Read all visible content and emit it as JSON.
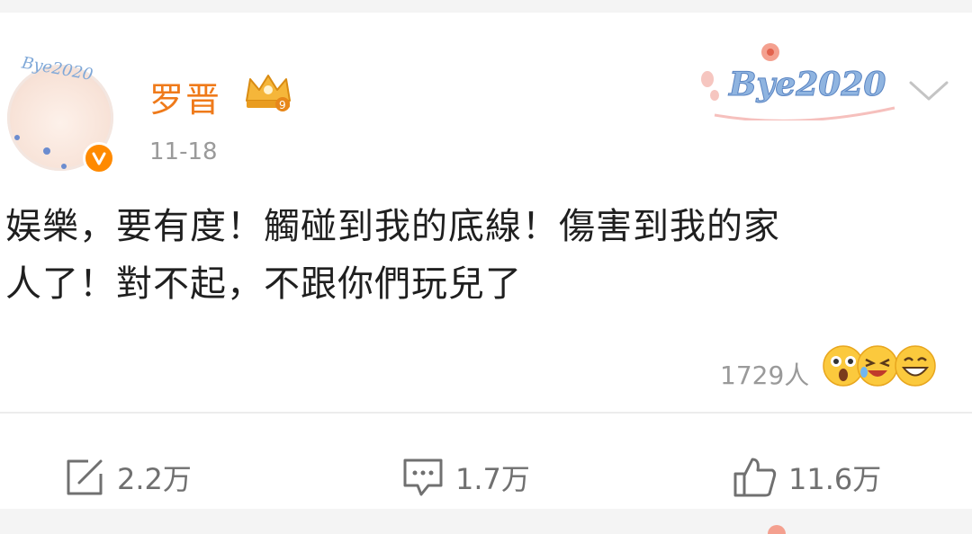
{
  "post": {
    "author": "罗晋",
    "date": "11-18",
    "avatar_badge_text": "Bye2020",
    "decoration_text": "Bye2020",
    "text_line1": "娱樂，要有度！觸碰到我的底線！傷害到我的家",
    "text_line2": "人了！對不起，不跟你們玩兒了",
    "reaction_count": "1729人"
  },
  "actions": {
    "repost": "2.2万",
    "comment": "1.7万",
    "like": "11.6万"
  },
  "icons": {
    "verified": "verified-v-icon",
    "crown": "vip-crown-icon",
    "chevron": "chevron-down-icon",
    "repost": "repost-icon",
    "comment": "comment-icon",
    "like": "like-icon"
  },
  "colors": {
    "username": "#ef7a1a",
    "verified": "#ff8a00",
    "text": "#1f1f1f",
    "muted": "#9a9a9a"
  }
}
